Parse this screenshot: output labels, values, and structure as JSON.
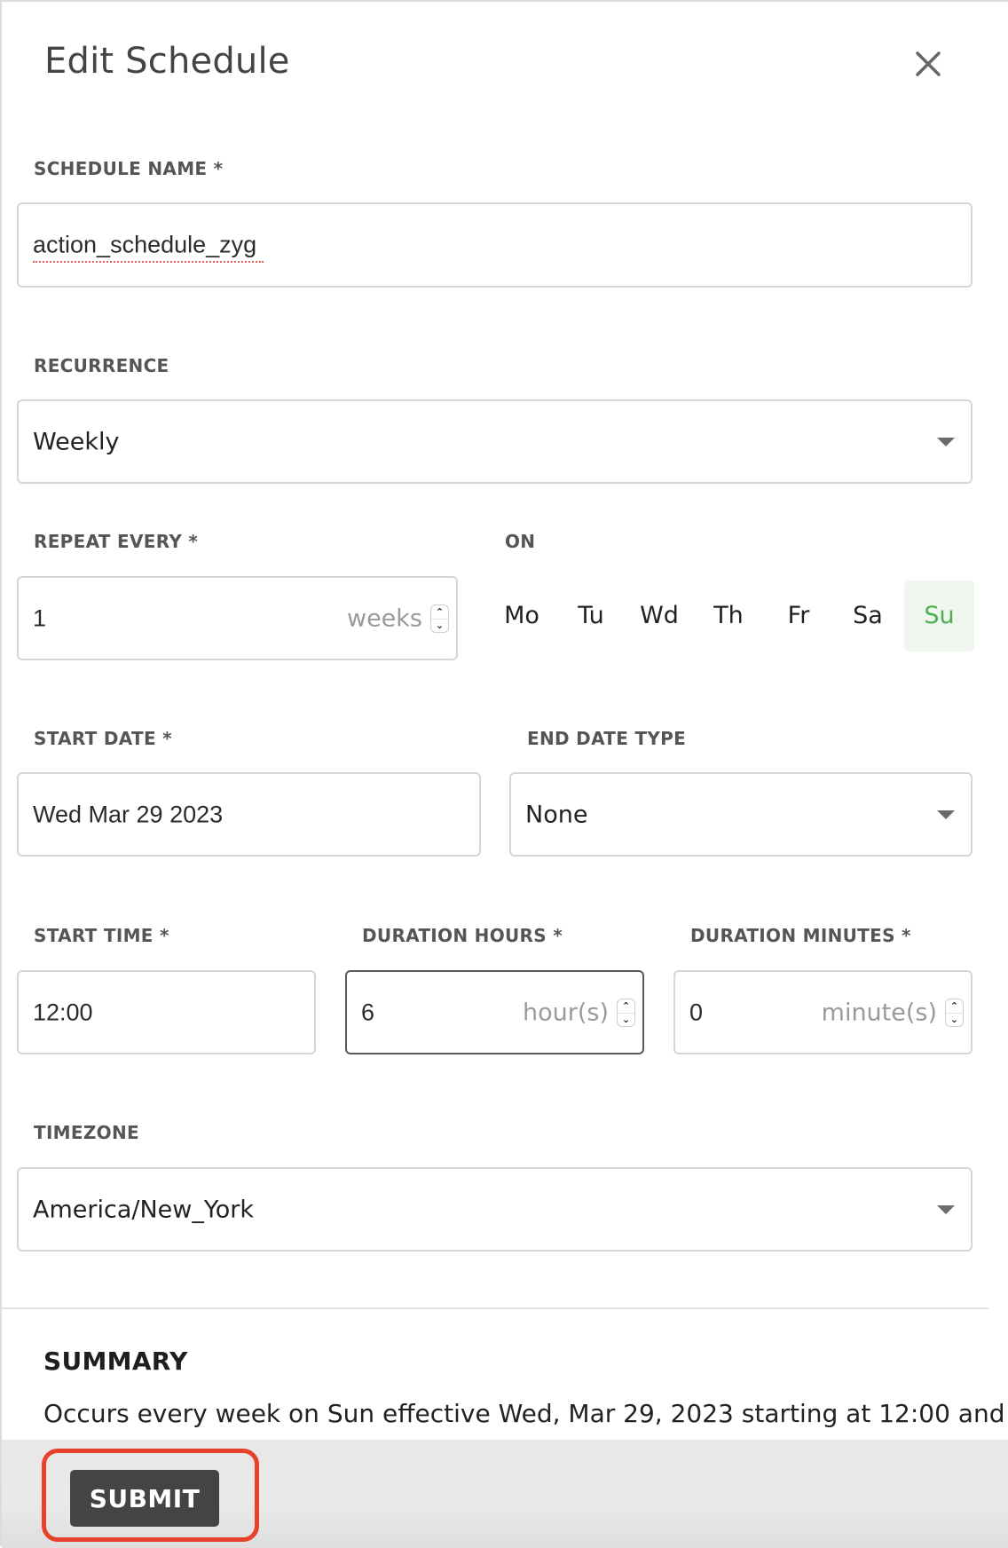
{
  "dialog": {
    "title": "Edit Schedule",
    "close_icon": "close-icon"
  },
  "fields": {
    "schedule_name": {
      "label": "SCHEDULE NAME *",
      "value": "action_schedule_zyg"
    },
    "recurrence": {
      "label": "RECURRENCE",
      "value": "Weekly"
    },
    "repeat_every": {
      "label": "REPEAT EVERY *",
      "value": "1",
      "unit": "weeks"
    },
    "on": {
      "label": "ON",
      "days": [
        {
          "label": "Mo",
          "selected": false
        },
        {
          "label": "Tu",
          "selected": false
        },
        {
          "label": "Wd",
          "selected": false
        },
        {
          "label": "Th",
          "selected": false
        },
        {
          "label": "Fr",
          "selected": false
        },
        {
          "label": "Sa",
          "selected": false
        },
        {
          "label": "Su",
          "selected": true
        }
      ]
    },
    "start_date": {
      "label": "START DATE *",
      "value": "Wed Mar 29 2023"
    },
    "end_date_type": {
      "label": "END DATE TYPE",
      "value": "None"
    },
    "start_time": {
      "label": "START TIME *",
      "value": "12:00"
    },
    "duration_hours": {
      "label": "DURATION HOURS *",
      "value": "6",
      "unit": "hour(s)"
    },
    "duration_minutes": {
      "label": "DURATION MINUTES *",
      "value": "0",
      "unit": "minute(s)"
    },
    "timezone": {
      "label": "TIMEZONE",
      "value": "America/New_York"
    }
  },
  "summary": {
    "title": "SUMMARY",
    "text": "Occurs every week on Sun effective Wed, Mar 29, 2023 starting at 12:00 and"
  },
  "footer": {
    "submit_label": "SUBMIT"
  },
  "colors": {
    "selected_day_text": "#4caf50",
    "selected_day_bg": "#eef6ee",
    "submit_bg": "#444444",
    "highlight": "#e8412b"
  }
}
